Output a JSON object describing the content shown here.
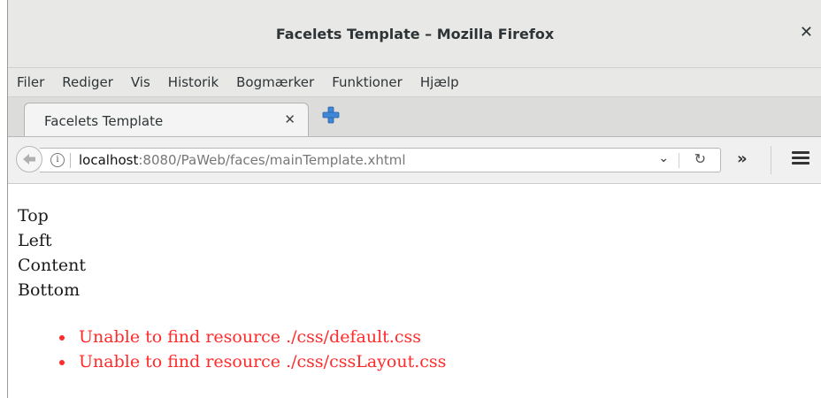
{
  "window": {
    "title": "Facelets Template – Mozilla Firefox"
  },
  "menu": [
    {
      "label": "Filer"
    },
    {
      "label": "Rediger"
    },
    {
      "label": "Vis"
    },
    {
      "label": "Historik"
    },
    {
      "label": "Bogmærker"
    },
    {
      "label": "Funktioner"
    },
    {
      "label": "Hjælp"
    }
  ],
  "tab": {
    "label": "Facelets Template"
  },
  "url": {
    "host": "localhost",
    "rest": ":8080/PaWeb/faces/mainTemplate.xhtml"
  },
  "page": {
    "lines": [
      "Top",
      "Left",
      "Content",
      "Bottom"
    ],
    "errors": [
      "Unable to find resource ./css/default.css",
      "Unable to find resource ./css/cssLayout.css"
    ]
  },
  "colors": {
    "error": "#ff2a2a",
    "chrome": "#e8e8e7"
  },
  "icons": {
    "close": "close-icon",
    "tab_close": "tab-close-icon",
    "new_tab": "plus-icon",
    "back": "back-arrow-icon",
    "info": "info-icon",
    "dropdown": "chevron-down-icon",
    "reload": "reload-icon",
    "overflow": "overflow-chevrons-icon",
    "menu": "hamburger-menu-icon"
  }
}
